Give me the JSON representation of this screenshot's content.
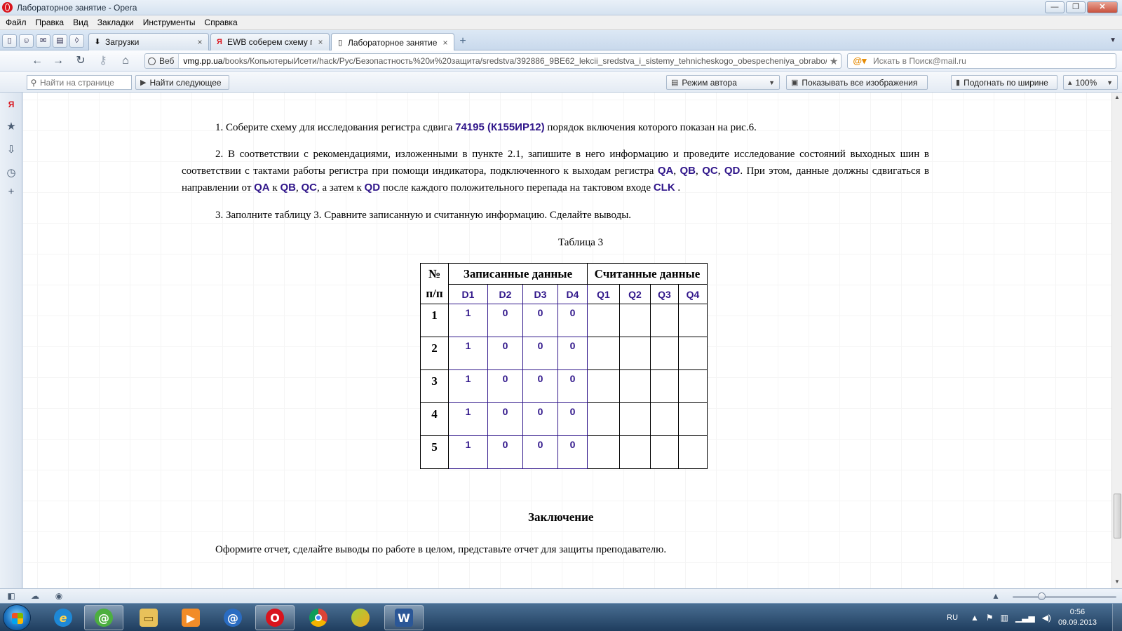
{
  "window": {
    "title": "Лабораторное занятие - Opera",
    "buttons": {
      "minimize": "—",
      "restore": "❐",
      "close": "✕"
    }
  },
  "menu": [
    "Файл",
    "Правка",
    "Вид",
    "Закладки",
    "Инструменты",
    "Справка"
  ],
  "tabs": [
    {
      "icon": "download-icon",
      "glyph": "⬇",
      "label": "Загрузки"
    },
    {
      "icon": "yandex-icon",
      "glyph": "Я",
      "label": "EWB соберем схему п..."
    },
    {
      "icon": "page-icon",
      "glyph": "▯",
      "label": "Лабораторное занятие"
    }
  ],
  "tab_close_glyph": "×",
  "navbar": {
    "address_badge": "Веб",
    "url_domain": "vmg.pp.ua",
    "url_path": "/books/КопьютерыИсети/hack/Рус/Безопастность%20и%20защита/sredstva/392886_9BE62_lekcii_sredstva_i_sistemy_tehnicheskogo_obespecheniya_obrabo/С",
    "search_placeholder": "Искать в Поиск@mail.ru"
  },
  "findbar": {
    "find_placeholder": "Найти на странице",
    "find_next": "Найти следующее",
    "author_mode": "Режим автора",
    "show_images": "Показывать все изображения",
    "fit_width": "Подогнать по ширине",
    "zoom": "100%"
  },
  "document": {
    "p1_prefix": "1.  Соберите схему для исследования регистра сдвига ",
    "p1_chip": "74195 (К155ИР12)",
    "p1_suffix": " порядок включения которого показан на рис.6.",
    "p2_a": "2.  В соответствии с рекомендациями, изложенными в пункте 2.1, запишите в него информацию и проведите исследование состояний выходных шин в соответствии с тактами работы регистра при помощи индикатора, подключенного к выходам регистра ",
    "p2_qa": "QA",
    "p2_sep1": ", ",
    "p2_qb": "QB",
    "p2_sep2": ", ",
    "p2_qc": "QC",
    "p2_sep3": ", ",
    "p2_qd": "QD",
    "p2_b": ". При этом, данные должны сдвигаться в направлении от ",
    "p2_qa2": "QA",
    "p2_c": " к ",
    "p2_qb2": "QB",
    "p2_sep4": ", ",
    "p2_qc2": "QC",
    "p2_d": ", а затем к ",
    "p2_qd2": "QD",
    "p2_e": " после каждого положительного перепада на тактовом входе ",
    "p2_clk": "CLK",
    "p2_f": " .",
    "p3": "3.  Заполните таблицу 3. Сравните записанную и считанную информацию. Сделайте выводы.",
    "table_caption": "Таблица 3",
    "table": {
      "h_num_top": "№",
      "h_num_bottom": "п/п",
      "h_written": "Записанные данные",
      "h_read": "Считанные данные",
      "d_cols": [
        "D1",
        "D2",
        "D3",
        "D4"
      ],
      "q_cols": [
        "Q1",
        "Q2",
        "Q3",
        "Q4"
      ],
      "rows": [
        {
          "n": "1",
          "d": [
            "1",
            "0",
            "0",
            "0"
          ]
        },
        {
          "n": "2",
          "d": [
            "1",
            "0",
            "0",
            "0"
          ]
        },
        {
          "n": "3",
          "d": [
            "1",
            "0",
            "0",
            "0"
          ]
        },
        {
          "n": "4",
          "d": [
            "1",
            "0",
            "0",
            "0"
          ]
        },
        {
          "n": "5",
          "d": [
            "1",
            "0",
            "0",
            "0"
          ]
        }
      ]
    },
    "conclusion_title": "Заключение",
    "conclusion_text": "Оформите отчет, сделайте выводы по работе в целом, представьте отчет для защиты преподавателю."
  },
  "taskbar": {
    "language": "RU",
    "time": "0:56",
    "date": "09.09.2013"
  },
  "colors": {
    "highlight": "#30168a",
    "opera_red": "#d9141d"
  }
}
